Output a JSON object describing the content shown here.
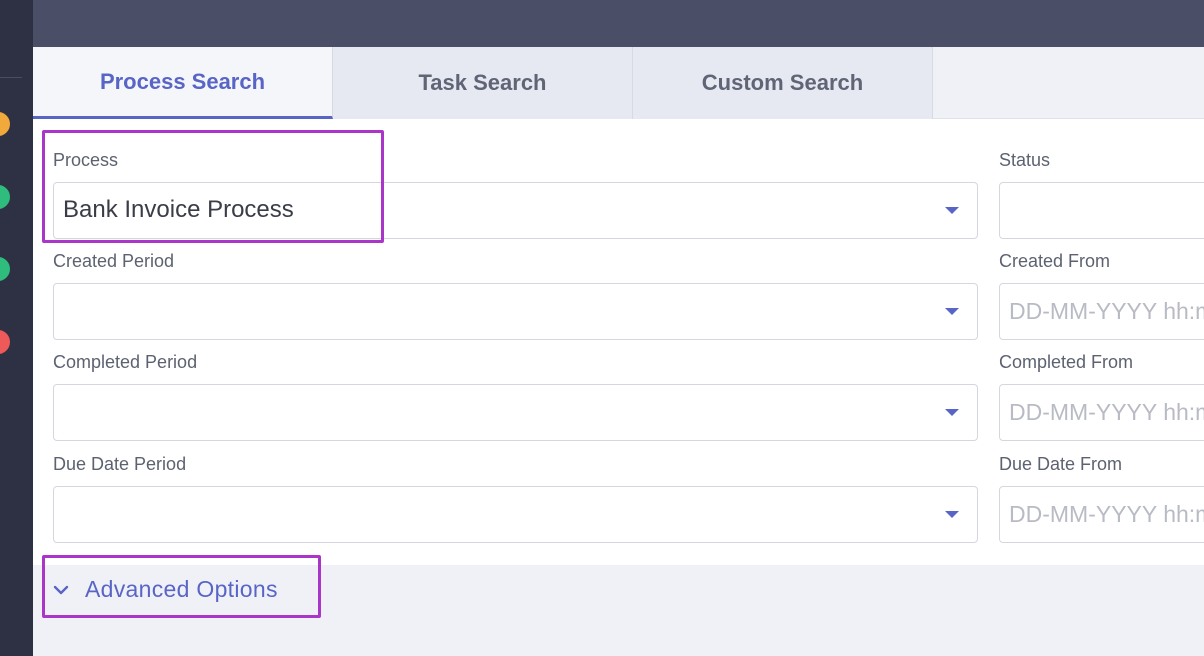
{
  "sidebar": {
    "status_dots": [
      {
        "icon": "orange-status-dot-icon",
        "color": "#f2a93b"
      },
      {
        "icon": "green-status-dot-icon",
        "color": "#2ebd7c"
      },
      {
        "icon": "green-status-dot-icon",
        "color": "#2ebd7c"
      },
      {
        "icon": "red-status-dot-icon",
        "color": "#ee5a5a"
      }
    ]
  },
  "tabs": [
    {
      "label": "Process Search",
      "active": true
    },
    {
      "label": "Task Search",
      "active": false
    },
    {
      "label": "Custom Search",
      "active": false
    }
  ],
  "form": {
    "process": {
      "label": "Process",
      "value": "Bank Invoice Process"
    },
    "status": {
      "label": "Status",
      "value": ""
    },
    "created_period": {
      "label": "Created Period",
      "value": ""
    },
    "created_from": {
      "label": "Created From",
      "placeholder": "DD-MM-YYYY hh:mm"
    },
    "completed_period": {
      "label": "Completed Period",
      "value": ""
    },
    "completed_from": {
      "label": "Completed From",
      "placeholder": "DD-MM-YYYY hh:mm"
    },
    "due_date_period": {
      "label": "Due Date Period",
      "value": ""
    },
    "due_date_from": {
      "label": "Due Date From",
      "placeholder": "DD-MM-YYYY hh:mm"
    }
  },
  "advanced_options": {
    "label": "Advanced Options"
  },
  "colors": {
    "accent": "#5865c7",
    "highlight": "#a935c9"
  }
}
